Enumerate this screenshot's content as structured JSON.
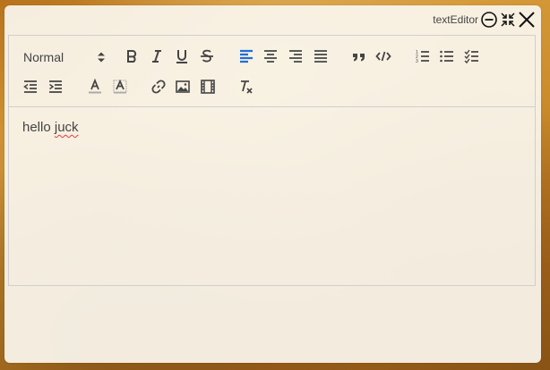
{
  "window": {
    "title": "textEditor"
  },
  "titlebar": {
    "buttons": [
      {
        "name": "minimize",
        "icon": "minus-circle-icon"
      },
      {
        "name": "restore",
        "icon": "compress-icon"
      },
      {
        "name": "close",
        "icon": "close-icon"
      }
    ]
  },
  "toolbar": {
    "header_select": {
      "value": "Normal",
      "icon": "up-down-arrows-icon"
    },
    "row1": [
      "bold-icon",
      "italic-icon",
      "underline-icon",
      "strikethrough-icon",
      "align-left-icon",
      "align-center-icon",
      "align-right-icon",
      "align-justify-icon",
      "blockquote-icon",
      "code-block-icon",
      "ordered-list-icon",
      "bullet-list-icon",
      "checklist-icon"
    ],
    "row2": [
      "outdent-icon",
      "indent-icon",
      "text-color-icon",
      "background-color-icon",
      "link-icon",
      "image-icon",
      "video-icon",
      "clear-format-icon"
    ],
    "active": "align-left-icon",
    "accent_color": "#1e6fd9"
  },
  "content": {
    "text_before": "hello ",
    "text_misspelled": "juck"
  }
}
